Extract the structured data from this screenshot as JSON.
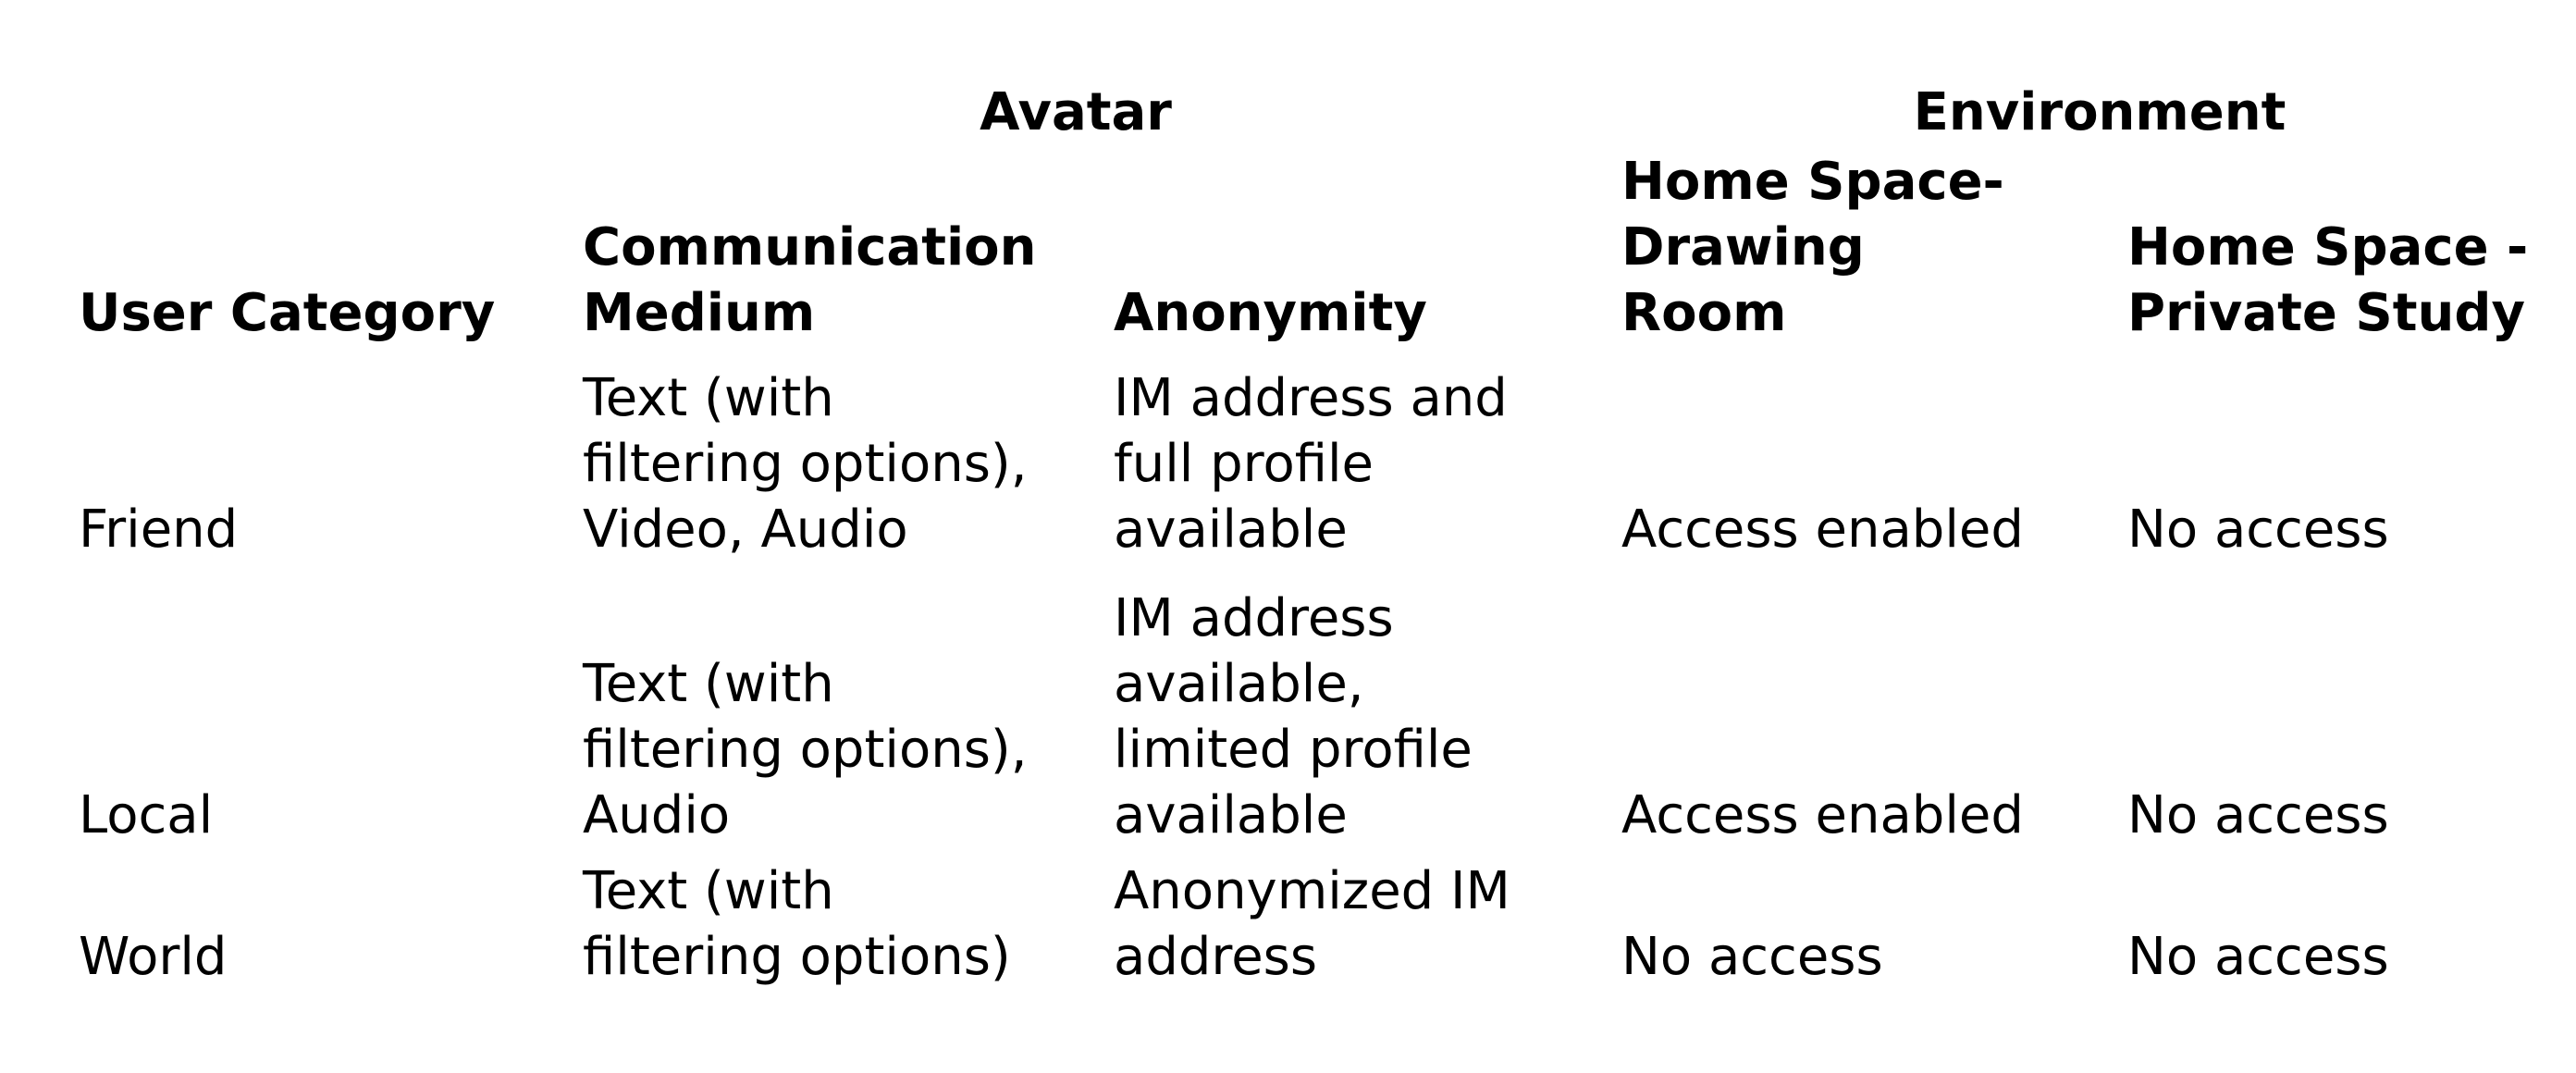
{
  "table": {
    "group_headers": [
      {
        "label": "Avatar"
      },
      {
        "label": "Environment"
      }
    ],
    "columns": [
      {
        "lines": [
          "User Category"
        ]
      },
      {
        "lines": [
          "Communication",
          "Medium"
        ]
      },
      {
        "lines": [
          "Anonymity"
        ]
      },
      {
        "lines": [
          "Home Space-",
          "Drawing",
          "Room"
        ]
      },
      {
        "lines": [
          "Home Space -",
          "Private Study"
        ]
      }
    ],
    "rows": [
      {
        "category": [
          "Friend"
        ],
        "communication": [
          "Text (with",
          "filtering options),",
          "Video, Audio"
        ],
        "anonymity": [
          "IM address and",
          "full profile",
          "available"
        ],
        "drawing_room": [
          "Access enabled"
        ],
        "private_study": [
          "No access"
        ]
      },
      {
        "category": [
          "Local"
        ],
        "communication": [
          "Text (with",
          "filtering options),",
          "Audio"
        ],
        "anonymity": [
          "IM address",
          "available,",
          "limited profile",
          "available"
        ],
        "drawing_room": [
          "Access enabled"
        ],
        "private_study": [
          "No access"
        ]
      },
      {
        "category": [
          "World"
        ],
        "communication": [
          "Text (with",
          "filtering options)"
        ],
        "anonymity": [
          "Anonymized IM",
          "address"
        ],
        "drawing_room": [
          "No access"
        ],
        "private_study": [
          "No access"
        ]
      }
    ]
  }
}
